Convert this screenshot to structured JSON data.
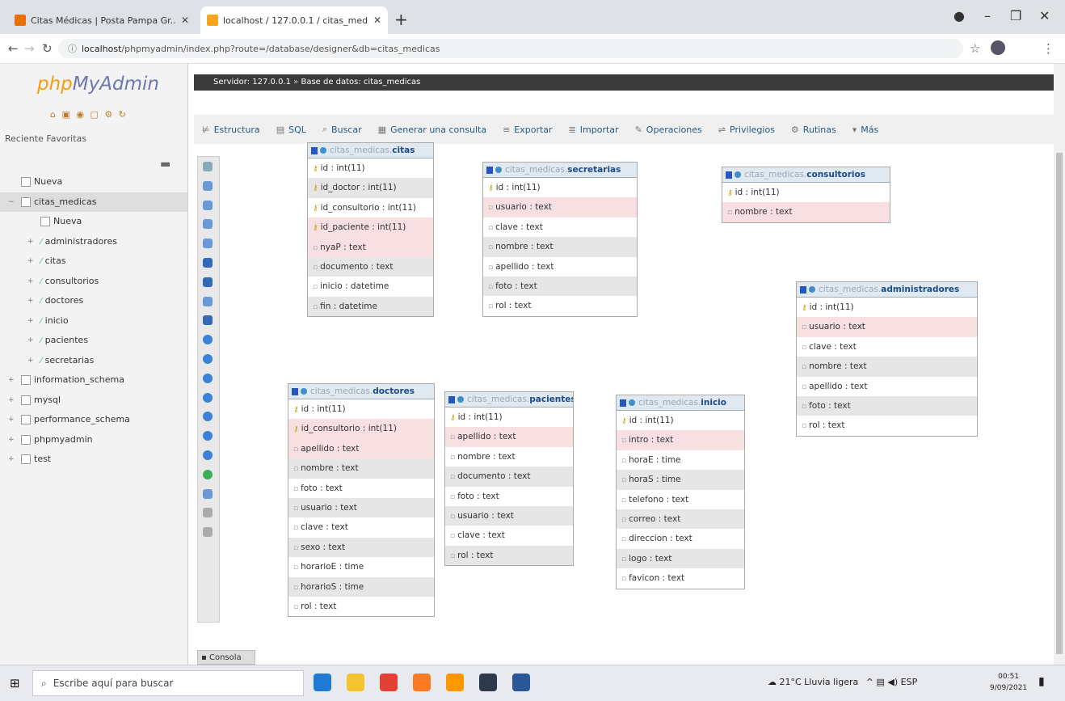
{
  "browser": {
    "tabs": [
      {
        "title": "Citas Médicas | Posta Pampa Gr...",
        "active": false,
        "favicon_color": "#e8710a"
      },
      {
        "title": "localhost / 127.0.0.1 / citas_med...",
        "active": true,
        "favicon_color": "#f8a51b"
      }
    ],
    "new_tab_icon": "+",
    "url_host": "localhost",
    "url_path": "/phpmyadmin/index.php?route=/database/designer&db=citas_medicas"
  },
  "sidebar": {
    "logo_php": "php",
    "logo_my": "MyAdmin",
    "recientes": "Reciente",
    "favoritas": "Favoritas",
    "tree": [
      {
        "label": "Nueva",
        "indent": 0,
        "type": "new"
      },
      {
        "label": "citas_medicas",
        "indent": 0,
        "type": "db",
        "selected": true
      },
      {
        "label": "Nueva",
        "indent": 1,
        "type": "new"
      },
      {
        "label": "administradores",
        "indent": 1,
        "type": "table"
      },
      {
        "label": "citas",
        "indent": 1,
        "type": "table"
      },
      {
        "label": "consultorios",
        "indent": 1,
        "type": "table"
      },
      {
        "label": "doctores",
        "indent": 1,
        "type": "table"
      },
      {
        "label": "inicio",
        "indent": 1,
        "type": "table"
      },
      {
        "label": "pacientes",
        "indent": 1,
        "type": "table"
      },
      {
        "label": "secretarias",
        "indent": 1,
        "type": "table"
      },
      {
        "label": "information_schema",
        "indent": 0,
        "type": "db"
      },
      {
        "label": "mysql",
        "indent": 0,
        "type": "db"
      },
      {
        "label": "performance_schema",
        "indent": 0,
        "type": "db"
      },
      {
        "label": "phpmyadmin",
        "indent": 0,
        "type": "db"
      },
      {
        "label": "test",
        "indent": 0,
        "type": "db"
      }
    ]
  },
  "breadcrumb": {
    "server": "Servidor: 127.0.0.1",
    "database": "Base de datos: citas_medicas"
  },
  "menu": [
    {
      "label": "Estructura",
      "icon": "structure-icon"
    },
    {
      "label": "SQL",
      "icon": "sql-icon"
    },
    {
      "label": "Buscar",
      "icon": "search-icon"
    },
    {
      "label": "Generar una consulta",
      "icon": "query-icon"
    },
    {
      "label": "Exportar",
      "icon": "export-icon"
    },
    {
      "label": "Importar",
      "icon": "import-icon"
    },
    {
      "label": "Operaciones",
      "icon": "operations-icon"
    },
    {
      "label": "Privilegios",
      "icon": "privileges-icon"
    },
    {
      "label": "Rutinas",
      "icon": "routines-icon"
    },
    {
      "label": "Más",
      "icon": "more-icon"
    }
  ],
  "db_prefix": "citas_medicas",
  "designer_tables": [
    {
      "name": "citas",
      "fields": [
        "id : int(11)",
        "id_doctor : int(11)",
        "id_consultorio : int(11)",
        "id_paciente : int(11)",
        "nyaP : text",
        "documento : text",
        "inicio : datetime",
        "fin : datetime"
      ]
    },
    {
      "name": "secretarias",
      "fields": [
        "id : int(11)",
        "usuario : text",
        "clave : text",
        "nombre : text",
        "apellido : text",
        "foto : text",
        "rol : text"
      ]
    },
    {
      "name": "consultorios",
      "fields": [
        "id : int(11)",
        "nombre : text"
      ]
    },
    {
      "name": "administradores",
      "fields": [
        "id : int(11)",
        "usuario : text",
        "clave : text",
        "nombre : text",
        "apellido : text",
        "foto : text",
        "rol : text"
      ]
    },
    {
      "name": "doctores",
      "fields": [
        "id : int(11)",
        "id_consultorio : int(11)",
        "apellido : text",
        "nombre : text",
        "foto : text",
        "usuario : text",
        "clave : text",
        "sexo : text",
        "horarioE : time",
        "horarioS : time",
        "rol : text"
      ]
    },
    {
      "name": "pacientes",
      "fields": [
        "id : int(11)",
        "apellido : text",
        "nombre : text",
        "documento : text",
        "foto : text",
        "usuario : text",
        "clave : text",
        "rol : text"
      ]
    },
    {
      "name": "inicio",
      "fields": [
        "id : int(11)",
        "intro : text",
        "horaE : time",
        "horaS : time",
        "telefono : text",
        "correo : text",
        "direccion : text",
        "logo : text",
        "favicon : text"
      ]
    }
  ],
  "console_label": "Consola",
  "taskbar": {
    "search_placeholder": "Escribe aquí para buscar",
    "weather": "21°C  Lluvia ligera",
    "lang": "ESP",
    "time": "00:51",
    "date": "9/09/2021",
    "apps": [
      {
        "name": "edge-app-icon",
        "color": "#1f7ad4"
      },
      {
        "name": "file-explorer-app-icon",
        "color": "#f4c430"
      },
      {
        "name": "chrome-app-icon",
        "color": "#e34133"
      },
      {
        "name": "xampp-app-icon",
        "color": "#fb7a24"
      },
      {
        "name": "sublime-app-icon",
        "color": "#ff9800"
      },
      {
        "name": "photos-app-icon",
        "color": "#2d3a4e"
      },
      {
        "name": "word-app-icon",
        "color": "#2b5797"
      }
    ]
  }
}
